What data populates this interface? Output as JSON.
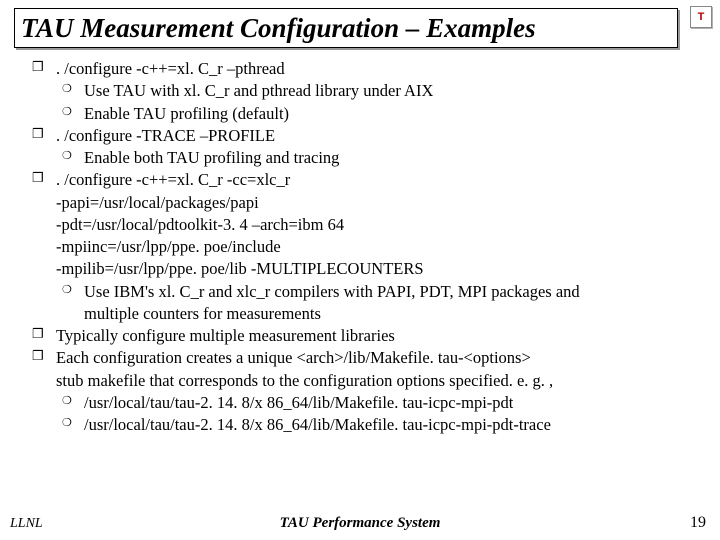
{
  "title": "TAU Measurement Configuration – Examples",
  "logo": "T",
  "content": [
    {
      "lvl": 1,
      "text": ". /configure -c++=xl. C_r –pthread"
    },
    {
      "lvl": 2,
      "text": "Use TAU with xl. C_r and pthread library under AIX"
    },
    {
      "lvl": 2,
      "text": "Enable TAU profiling (default)"
    },
    {
      "lvl": 1,
      "text": ". /configure -TRACE –PROFILE"
    },
    {
      "lvl": 2,
      "text": "Enable both TAU profiling and tracing"
    },
    {
      "lvl": 1,
      "text": ". /configure -c++=xl. C_r -cc=xlc_r"
    },
    {
      "lvl": "1c",
      "text": "-papi=/usr/local/packages/papi"
    },
    {
      "lvl": "1c",
      "text": "-pdt=/usr/local/pdtoolkit-3. 4 –arch=ibm 64"
    },
    {
      "lvl": "1c",
      "text": "-mpiinc=/usr/lpp/ppe. poe/include"
    },
    {
      "lvl": "1c",
      "text": "-mpilib=/usr/lpp/ppe. poe/lib -MULTIPLECOUNTERS"
    },
    {
      "lvl": 2,
      "text": "Use IBM's xl. C_r and xlc_r compilers with PAPI, PDT, MPI packages and"
    },
    {
      "lvl": "2c",
      "text": "multiple counters for measurements"
    },
    {
      "lvl": 1,
      "text": "Typically configure multiple measurement libraries"
    },
    {
      "lvl": 1,
      "text": "Each configuration creates a  unique <arch>/lib/Makefile. tau-<options>"
    },
    {
      "lvl": "1c",
      "text": "stub makefile that corresponds to the configuration options specified. e. g. ,"
    },
    {
      "lvl": 2,
      "text": "/usr/local/tau/tau-2. 14. 8/x 86_64/lib/Makefile. tau-icpc-mpi-pdt"
    },
    {
      "lvl": 2,
      "text": "/usr/local/tau/tau-2. 14. 8/x 86_64/lib/Makefile. tau-icpc-mpi-pdt-trace"
    }
  ],
  "footer": {
    "left": "LLNL",
    "center": "TAU Performance System",
    "right": "19"
  }
}
